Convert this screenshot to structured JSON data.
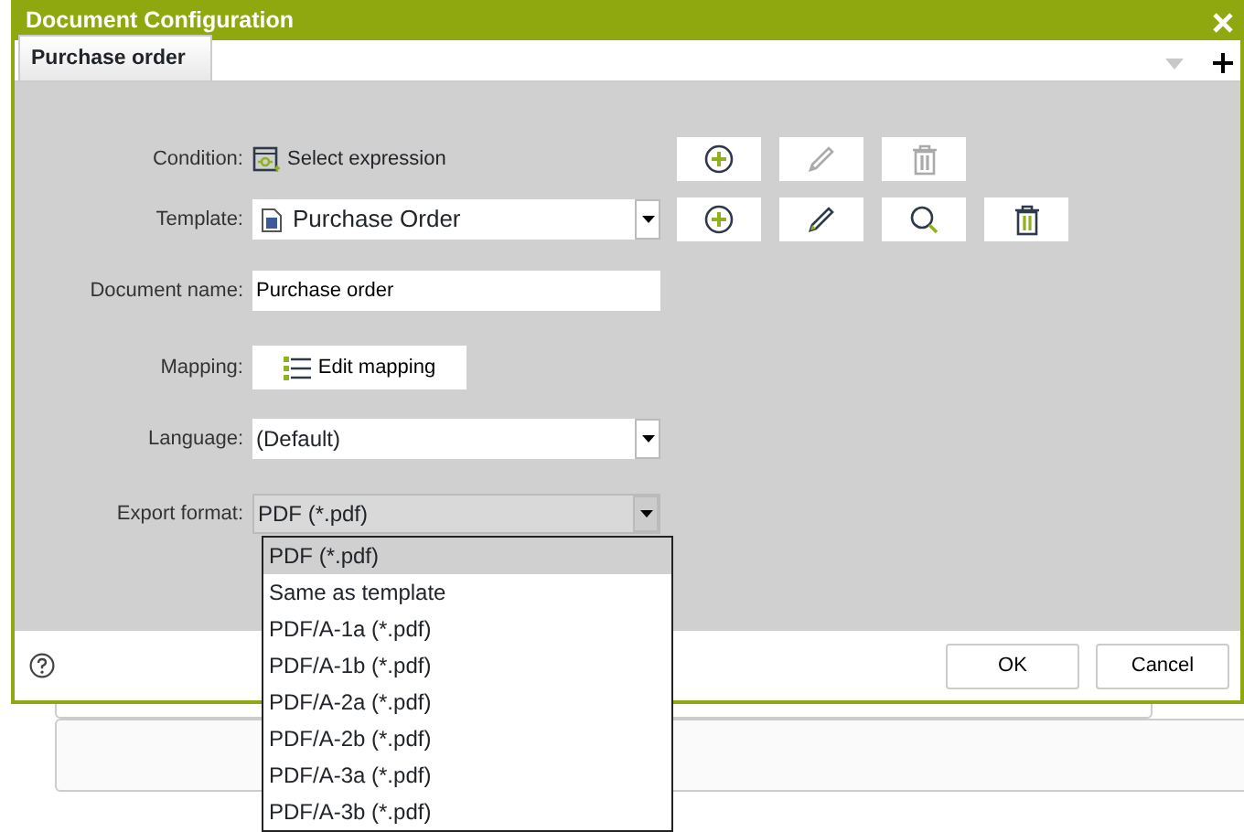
{
  "window": {
    "title": "Document Configuration"
  },
  "tabs": [
    {
      "label": "Purchase order",
      "selected": true
    }
  ],
  "rows": [
    {
      "kind": "expression",
      "label": "Condition:",
      "value": "Select expression",
      "buttons": [
        {
          "kind": "add",
          "disabled": false
        },
        {
          "kind": "edit",
          "disabled": true
        },
        {
          "kind": "delete",
          "disabled": true
        }
      ]
    },
    {
      "kind": "file",
      "label": "Template:",
      "value": "Purchase Order",
      "buttons": [
        {
          "kind": "add",
          "disabled": false
        },
        {
          "kind": "edit",
          "disabled": false
        },
        {
          "kind": "search",
          "disabled": false
        },
        {
          "kind": "delete",
          "disabled": false
        }
      ]
    },
    {
      "kind": "text",
      "label": "Document name:",
      "value": "Purchase order"
    },
    {
      "kind": "mapping",
      "label": "Mapping:",
      "value": "Edit mapping"
    },
    {
      "kind": "select",
      "label": "Language:",
      "value": "(Default)",
      "expanded": false
    },
    {
      "kind": "select",
      "label": "Export format:",
      "value": "PDF (*.pdf)",
      "expanded": true,
      "options": [
        {
          "label": "PDF (*.pdf)",
          "selected": true
        },
        {
          "label": "Same as template",
          "selected": false
        },
        {
          "label": "PDF/A-1a (*.pdf)",
          "selected": false
        },
        {
          "label": "PDF/A-1b (*.pdf)",
          "selected": false
        },
        {
          "label": "PDF/A-2a (*.pdf)",
          "selected": false
        },
        {
          "label": "PDF/A-2b (*.pdf)",
          "selected": false
        },
        {
          "label": "PDF/A-3a (*.pdf)",
          "selected": false
        },
        {
          "label": "PDF/A-3b (*.pdf)",
          "selected": false
        }
      ]
    }
  ],
  "footer": {
    "buttons": [
      "OK",
      "Cancel"
    ]
  }
}
